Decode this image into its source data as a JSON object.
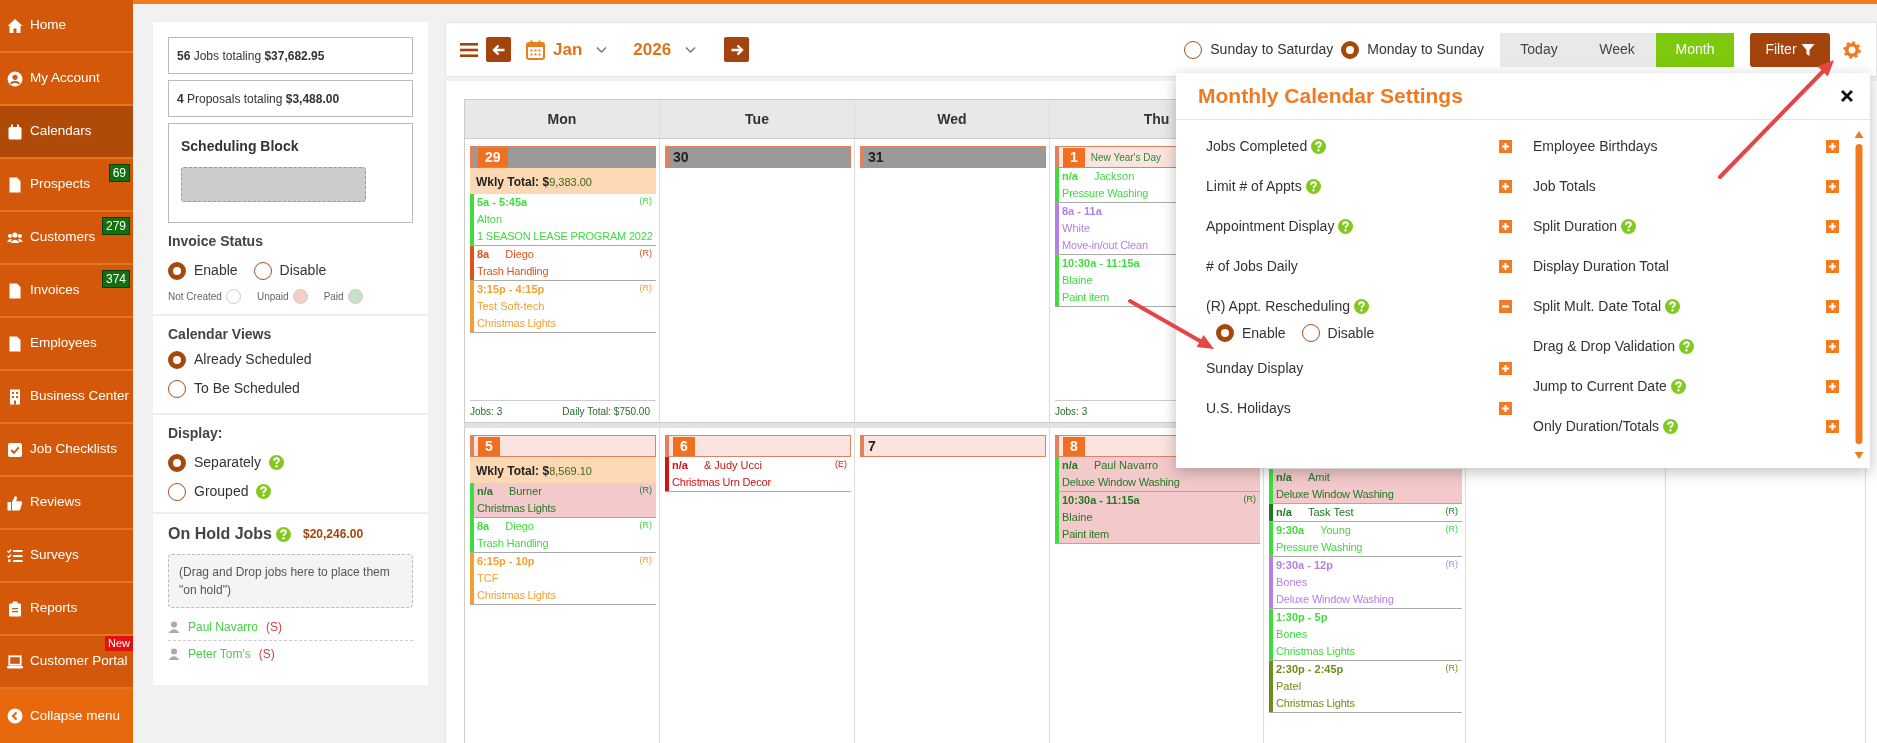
{
  "sidebar": {
    "items": [
      {
        "label": "Home",
        "selected": false
      },
      {
        "label": "My Account",
        "selected": false
      },
      {
        "label": "Calendars",
        "selected": true
      },
      {
        "label": "Prospects",
        "selected": false,
        "count": "69"
      },
      {
        "label": "Customers",
        "selected": false,
        "count": "279"
      },
      {
        "label": "Invoices",
        "selected": false,
        "count": "374"
      },
      {
        "label": "Employees",
        "selected": false
      },
      {
        "label": "Business Center",
        "selected": false
      },
      {
        "label": "Job Checklists",
        "selected": false
      },
      {
        "label": "Reviews",
        "selected": false
      },
      {
        "label": "Surveys",
        "selected": false
      },
      {
        "label": "Reports",
        "selected": false
      },
      {
        "label": "Customer Portal",
        "selected": false,
        "tag": "New"
      }
    ],
    "collapse": "Collapse menu"
  },
  "summary": [
    "**56** Jobs totaling **$37,682.95**",
    "**4** Proposals totaling **$3,488.00**"
  ],
  "scheduling_block": {
    "title": "Scheduling Block"
  },
  "invoice_status": {
    "title": "Invoice Status",
    "options": [
      {
        "label": "Enable",
        "selected": true
      },
      {
        "label": "Disable",
        "selected": false
      }
    ],
    "legend": [
      {
        "label": "Not Created",
        "color": "#ffffff"
      },
      {
        "label": "Unpaid",
        "color": "#f2cfc4"
      },
      {
        "label": "Paid",
        "color": "#c6e3c8"
      }
    ]
  },
  "calendar_views": {
    "title": "Calendar Views",
    "options": [
      {
        "label": "Already Scheduled",
        "selected": true
      },
      {
        "label": "To Be Scheduled",
        "selected": false
      }
    ]
  },
  "display": {
    "title": "Display:",
    "options": [
      {
        "label": "Separately",
        "selected": true,
        "help": true
      },
      {
        "label": "Grouped",
        "selected": false,
        "help": true
      }
    ]
  },
  "on_hold": {
    "title": "On Hold Jobs",
    "help": true,
    "amount": "$20,246.00",
    "drop_hint": "(Drag and Drop jobs here to place them \"on hold\")",
    "jobs": [
      {
        "name": "Paul Navarro",
        "flag": "(S)"
      },
      {
        "name": "Peter Tom's",
        "flag": "(S)"
      }
    ]
  },
  "toolbar": {
    "month": "Jan",
    "year": "2026",
    "week_start": [
      {
        "label": "Sunday to Saturday",
        "selected": false
      },
      {
        "label": "Monday to Sunday",
        "selected": true
      }
    ],
    "views": [
      {
        "label": "Today",
        "selected": false
      },
      {
        "label": "Week",
        "selected": false
      },
      {
        "label": "Month",
        "selected": true
      }
    ],
    "filter": "Filter"
  },
  "calendar": {
    "weekdays": [
      "Mon",
      "Tue",
      "Wed",
      "Thu"
    ],
    "weeks": [
      {
        "weekly_label": "Wkly Total: $",
        "weekly_total": "9,383.00",
        "days": [
          {
            "date": "29",
            "in_month": false,
            "highlighted": true,
            "jobs": [
              {
                "kind": "stacked",
                "time": "5a - 5:45a",
                "name": "Alton",
                "service": "1 SEASON LEASE PROGRAM 2022",
                "flag": "(R)",
                "color": "#3fdc3f",
                "unpaid": false
              },
              {
                "kind": "inline",
                "time": "8a",
                "name": "Diego",
                "service": "Trash Handling",
                "flag": "(R)",
                "color": "#e0521c",
                "unpaid": false
              },
              {
                "kind": "stacked",
                "time": "3:15p - 4:15p",
                "name": "Test Soft-tech",
                "service": "Christmas Lights",
                "flag": "(R)",
                "color": "#f0a030",
                "unpaid": false
              }
            ],
            "jobs_count": "Jobs: 3",
            "daily_total": "Daily Total: $750.00"
          },
          {
            "date": "30",
            "in_month": false,
            "highlighted": false
          },
          {
            "date": "31",
            "in_month": false,
            "highlighted": false
          },
          {
            "date": "1",
            "in_month": true,
            "highlighted": true,
            "holiday": "New Year's Day",
            "jobs": [
              {
                "kind": "inline",
                "time": "n/a",
                "name": "Jackson",
                "service": "Pressure Washing",
                "color": "#3fdc3f",
                "unpaid": false
              },
              {
                "kind": "stacked",
                "time": "8a - 11a",
                "name": "White",
                "service": "Move-in/out Clean",
                "color": "#b47fe6",
                "unpaid": false
              },
              {
                "kind": "stacked",
                "time": "10:30a - 11:15a",
                "name": "Blaine",
                "service": "Paint item",
                "color": "#3fdc3f",
                "unpaid": false
              }
            ],
            "jobs_count": "Jobs: 3"
          }
        ]
      },
      {
        "weekly_label": "Wkly Total: $",
        "weekly_total": "8,569.10",
        "days": [
          {
            "date": "5",
            "in_month": true,
            "highlighted": true,
            "jobs": [
              {
                "kind": "inline",
                "time": "n/a",
                "name": "Burner",
                "service": "Christmas Lights",
                "flag": "(R)",
                "color": "#3fdc3f",
                "unpaid": true
              },
              {
                "kind": "inline",
                "time": "8a",
                "name": "Diego",
                "service": "Trash Handling",
                "flag": "(R)",
                "color": "#3fdc3f",
                "unpaid": false
              },
              {
                "kind": "stacked",
                "time": "6:15p - 10p",
                "name": "TCF",
                "service": "Christmas Lights",
                "flag": "(R)",
                "color": "#f0a030",
                "unpaid": false
              }
            ]
          },
          {
            "date": "6",
            "in_month": true,
            "highlighted": true,
            "jobs": [
              {
                "kind": "inline",
                "time": "n/a",
                "name": "& Judy Ucci",
                "service": "Christmas Urn Decor",
                "flag": "(E)",
                "color": "#d41414",
                "unpaid": false
              }
            ]
          },
          {
            "date": "7",
            "in_month": true,
            "highlighted": false
          },
          {
            "date": "8",
            "in_month": true,
            "highlighted": true,
            "jobs": [
              {
                "kind": "inline",
                "time": "n/a",
                "name": "Paul Navarro",
                "service": "Deluxe Window Washing",
                "color": "#3fdc3f",
                "unpaid": true
              },
              {
                "kind": "stacked",
                "time": "10:30a - 11:15a",
                "name": "Blaine",
                "service": "Paint item",
                "flag": "(R)",
                "color": "#3fdc3f",
                "unpaid": true
              }
            ]
          },
          {
            "jobs": [
              {
                "kind": "inline",
                "time": "n/a",
                "name": "Amit",
                "service": "Deluxe Window Washing",
                "color": "#3fdc3f",
                "unpaid": true
              },
              {
                "kind": "inline",
                "time": "n/a",
                "name": "Task Test",
                "flag": "(R)",
                "color": "#1e7a1e",
                "unpaid": false
              },
              {
                "kind": "inline",
                "time": "9:30a",
                "name": "Young",
                "service": "Pressure Washing",
                "flag": "(R)",
                "color": "#3fdc3f",
                "unpaid": false
              },
              {
                "kind": "stacked",
                "time": "9:30a - 12p",
                "name": "Bones",
                "service": "Deluxe Window Washing",
                "flag": "(R)",
                "color": "#b47fe6",
                "unpaid": false
              },
              {
                "kind": "stacked",
                "time": "1:30p - 5p",
                "name": "Bones",
                "service": "Christmas Lights",
                "color": "#3fdc3f",
                "unpaid": false
              },
              {
                "kind": "stacked",
                "time": "2:30p - 2:45p",
                "name": "Patel",
                "service": "Christmas Lights",
                "flag": "(R)",
                "color": "#6b8e1a",
                "unpaid": false
              }
            ]
          }
        ]
      }
    ]
  },
  "settings": {
    "title": "Monthly Calendar Settings",
    "columns": [
      [
        {
          "label": "Jobs Completed",
          "help": true,
          "expanded": false
        },
        {
          "label": "Limit # of Appts",
          "help": true,
          "expanded": false
        },
        {
          "label": "Appointment Display",
          "help": true,
          "expanded": false
        },
        {
          "label": "# of Jobs Daily",
          "expanded": false
        },
        {
          "label": "(R) Appt. Rescheduling",
          "help": true,
          "expanded": true,
          "options": [
            {
              "label": "Enable",
              "selected": true
            },
            {
              "label": "Disable",
              "selected": false
            }
          ]
        },
        {
          "label": "Sunday Display",
          "expanded": false
        },
        {
          "label": "U.S. Holidays",
          "expanded": false
        }
      ],
      [
        {
          "label": "Employee Birthdays",
          "expanded": false
        },
        {
          "label": "Job Totals",
          "expanded": false
        },
        {
          "label": "Split Duration",
          "help": true,
          "expanded": false
        },
        {
          "label": "Display Duration Total",
          "expanded": false
        },
        {
          "label": "Split Mult. Date Total",
          "help": true,
          "expanded": false
        },
        {
          "label": "Drag & Drop Validation",
          "help": true,
          "expanded": false
        },
        {
          "label": "Jump to Current Date",
          "help": true,
          "expanded": false
        },
        {
          "label": "Only Duration/Totals",
          "help": true,
          "expanded": false
        }
      ]
    ]
  }
}
